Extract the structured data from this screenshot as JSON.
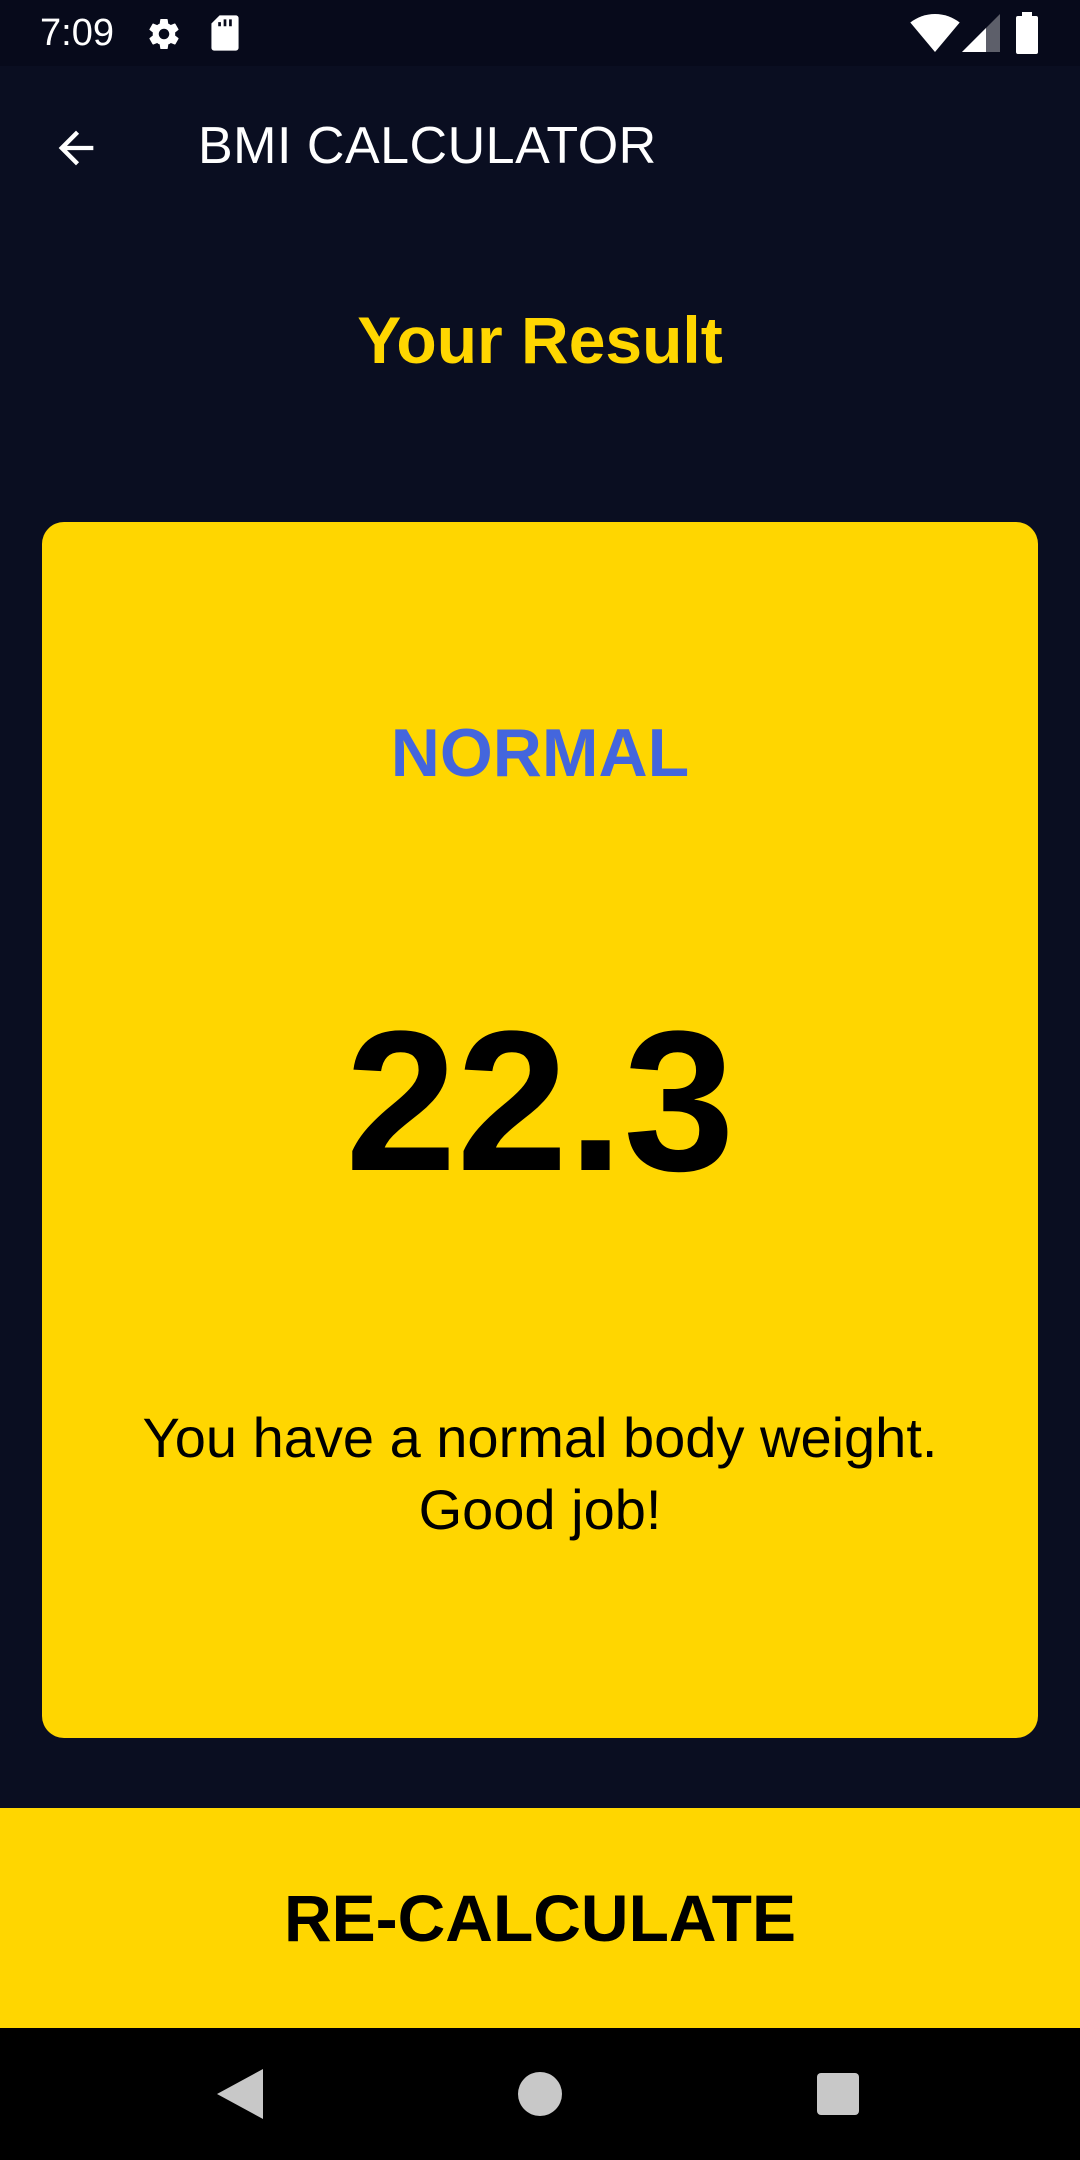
{
  "status_bar": {
    "time": "7:09",
    "icons": [
      "settings-gear-icon",
      "sd-card-icon",
      "wifi-icon",
      "cell-signal-icon",
      "battery-icon"
    ]
  },
  "app_bar": {
    "title": "BMI CALCULATOR",
    "back_icon": "arrow-back-icon"
  },
  "result": {
    "heading": "Your Result",
    "category": "NORMAL",
    "bmi": "22.3",
    "message": "You have a normal body weight. Good job!"
  },
  "actions": {
    "recalculate_label": "RE-CALCULATE"
  },
  "nav_bar": {
    "icons": [
      "back-triangle-icon",
      "home-circle-icon",
      "recents-square-icon"
    ]
  },
  "colors": {
    "background": "#0a0e21",
    "accent_yellow": "#ffd600",
    "category_blue": "#4466dd",
    "text_white": "#ffffff"
  }
}
